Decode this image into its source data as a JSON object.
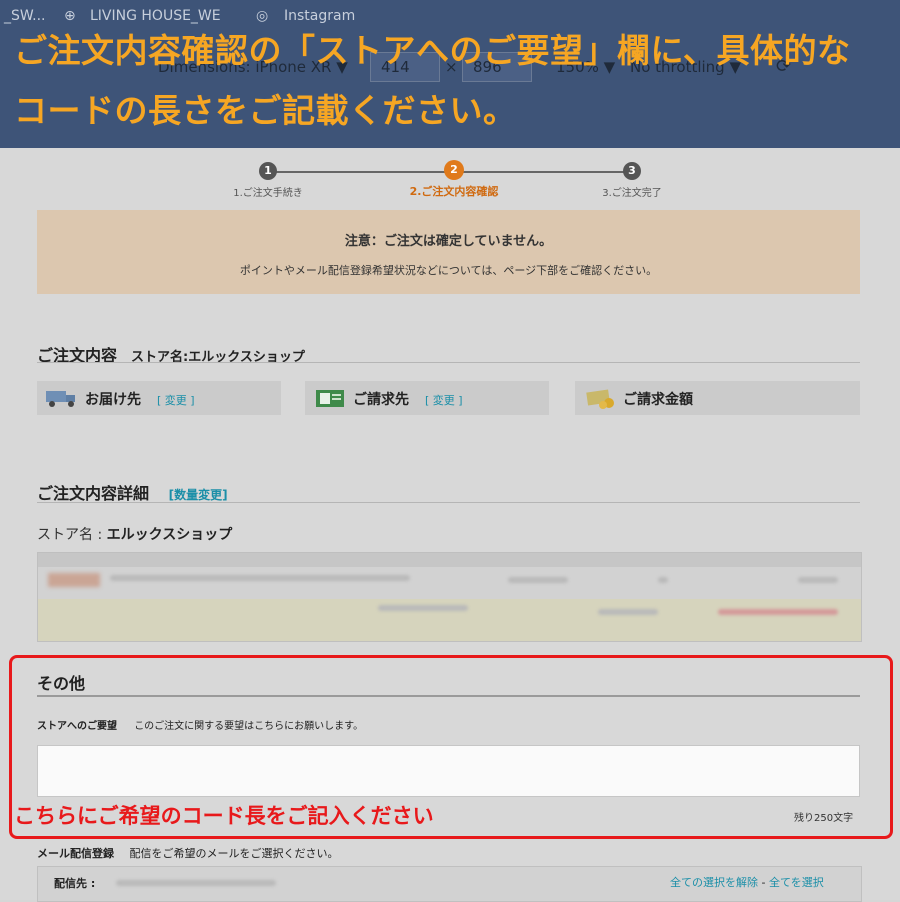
{
  "devtools": {
    "tab_1": "_SW...",
    "tab_2": "LIVING HOUSE_WE",
    "tab_3": "Instagram",
    "dimensions_label": "Dimensions: iPhone XR ▼",
    "width_value": "414",
    "height_value": "896",
    "times": "×",
    "zoom": "150% ▼",
    "throttle": "No throttling ▼"
  },
  "banner": {
    "line1": "ご注文内容確認の「ストアへのご要望」欄に、具体的な",
    "line2": "コードの長さをご記載ください。"
  },
  "steps": [
    {
      "num": "1",
      "label": "1.ご注文手続き",
      "active": false
    },
    {
      "num": "2",
      "label": "2.ご注文内容確認",
      "active": true
    },
    {
      "num": "3",
      "label": "3.ご注文完了",
      "active": false
    }
  ],
  "notice": {
    "title": "注意：ご注文は確定していません。",
    "body": "ポイントやメール配信登録希望状況などについては、ページ下部をご確認ください。"
  },
  "order": {
    "title": "ご注文内容",
    "store_label": "ストア名:エルックスショップ",
    "shipping_label": "お届け先",
    "billing_label": "ご請求先",
    "amount_label": "ご請求金額",
    "change_link": "[ 変更 ]"
  },
  "detail": {
    "title": "ご注文内容詳細",
    "qty_change": "[数量変更]",
    "store_prefix": "ストア名 : ",
    "store_name": "エルックスショップ"
  },
  "other": {
    "title": "その他",
    "request_label": "ストアへのご要望",
    "request_desc": "このご注文に関する要望はこちらにお願いします。",
    "hint": "こちらにご希望のコード長をご記入ください",
    "remaining": "残り250文字"
  },
  "mail": {
    "label": "メール配信登録",
    "desc": "配信をご希望のメールをご選択ください。",
    "dest_label": "配信先 :",
    "deselect_all": "全ての選択を解除",
    "separator": " - ",
    "select_all": "全てを選択"
  },
  "colors": {
    "accent": "#e07a1b",
    "hint_red": "#e8191b",
    "banner_bg": "#3e5478",
    "banner_text": "#f6a623",
    "link": "#1b8fa8"
  }
}
